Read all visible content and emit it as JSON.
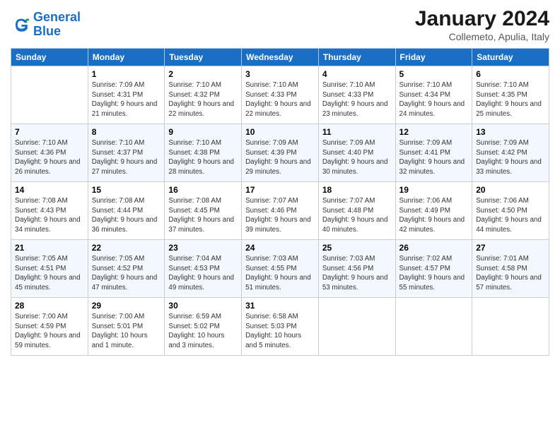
{
  "header": {
    "logo_general": "General",
    "logo_blue": "Blue",
    "month_title": "January 2024",
    "location": "Collemeto, Apulia, Italy"
  },
  "days_of_week": [
    "Sunday",
    "Monday",
    "Tuesday",
    "Wednesday",
    "Thursday",
    "Friday",
    "Saturday"
  ],
  "weeks": [
    [
      {
        "day": "",
        "sunrise": "",
        "sunset": "",
        "daylight": ""
      },
      {
        "day": "1",
        "sunrise": "Sunrise: 7:09 AM",
        "sunset": "Sunset: 4:31 PM",
        "daylight": "Daylight: 9 hours and 21 minutes."
      },
      {
        "day": "2",
        "sunrise": "Sunrise: 7:10 AM",
        "sunset": "Sunset: 4:32 PM",
        "daylight": "Daylight: 9 hours and 22 minutes."
      },
      {
        "day": "3",
        "sunrise": "Sunrise: 7:10 AM",
        "sunset": "Sunset: 4:33 PM",
        "daylight": "Daylight: 9 hours and 22 minutes."
      },
      {
        "day": "4",
        "sunrise": "Sunrise: 7:10 AM",
        "sunset": "Sunset: 4:33 PM",
        "daylight": "Daylight: 9 hours and 23 minutes."
      },
      {
        "day": "5",
        "sunrise": "Sunrise: 7:10 AM",
        "sunset": "Sunset: 4:34 PM",
        "daylight": "Daylight: 9 hours and 24 minutes."
      },
      {
        "day": "6",
        "sunrise": "Sunrise: 7:10 AM",
        "sunset": "Sunset: 4:35 PM",
        "daylight": "Daylight: 9 hours and 25 minutes."
      }
    ],
    [
      {
        "day": "7",
        "sunrise": "Sunrise: 7:10 AM",
        "sunset": "Sunset: 4:36 PM",
        "daylight": "Daylight: 9 hours and 26 minutes."
      },
      {
        "day": "8",
        "sunrise": "Sunrise: 7:10 AM",
        "sunset": "Sunset: 4:37 PM",
        "daylight": "Daylight: 9 hours and 27 minutes."
      },
      {
        "day": "9",
        "sunrise": "Sunrise: 7:10 AM",
        "sunset": "Sunset: 4:38 PM",
        "daylight": "Daylight: 9 hours and 28 minutes."
      },
      {
        "day": "10",
        "sunrise": "Sunrise: 7:09 AM",
        "sunset": "Sunset: 4:39 PM",
        "daylight": "Daylight: 9 hours and 29 minutes."
      },
      {
        "day": "11",
        "sunrise": "Sunrise: 7:09 AM",
        "sunset": "Sunset: 4:40 PM",
        "daylight": "Daylight: 9 hours and 30 minutes."
      },
      {
        "day": "12",
        "sunrise": "Sunrise: 7:09 AM",
        "sunset": "Sunset: 4:41 PM",
        "daylight": "Daylight: 9 hours and 32 minutes."
      },
      {
        "day": "13",
        "sunrise": "Sunrise: 7:09 AM",
        "sunset": "Sunset: 4:42 PM",
        "daylight": "Daylight: 9 hours and 33 minutes."
      }
    ],
    [
      {
        "day": "14",
        "sunrise": "Sunrise: 7:08 AM",
        "sunset": "Sunset: 4:43 PM",
        "daylight": "Daylight: 9 hours and 34 minutes."
      },
      {
        "day": "15",
        "sunrise": "Sunrise: 7:08 AM",
        "sunset": "Sunset: 4:44 PM",
        "daylight": "Daylight: 9 hours and 36 minutes."
      },
      {
        "day": "16",
        "sunrise": "Sunrise: 7:08 AM",
        "sunset": "Sunset: 4:45 PM",
        "daylight": "Daylight: 9 hours and 37 minutes."
      },
      {
        "day": "17",
        "sunrise": "Sunrise: 7:07 AM",
        "sunset": "Sunset: 4:46 PM",
        "daylight": "Daylight: 9 hours and 39 minutes."
      },
      {
        "day": "18",
        "sunrise": "Sunrise: 7:07 AM",
        "sunset": "Sunset: 4:48 PM",
        "daylight": "Daylight: 9 hours and 40 minutes."
      },
      {
        "day": "19",
        "sunrise": "Sunrise: 7:06 AM",
        "sunset": "Sunset: 4:49 PM",
        "daylight": "Daylight: 9 hours and 42 minutes."
      },
      {
        "day": "20",
        "sunrise": "Sunrise: 7:06 AM",
        "sunset": "Sunset: 4:50 PM",
        "daylight": "Daylight: 9 hours and 44 minutes."
      }
    ],
    [
      {
        "day": "21",
        "sunrise": "Sunrise: 7:05 AM",
        "sunset": "Sunset: 4:51 PM",
        "daylight": "Daylight: 9 hours and 45 minutes."
      },
      {
        "day": "22",
        "sunrise": "Sunrise: 7:05 AM",
        "sunset": "Sunset: 4:52 PM",
        "daylight": "Daylight: 9 hours and 47 minutes."
      },
      {
        "day": "23",
        "sunrise": "Sunrise: 7:04 AM",
        "sunset": "Sunset: 4:53 PM",
        "daylight": "Daylight: 9 hours and 49 minutes."
      },
      {
        "day": "24",
        "sunrise": "Sunrise: 7:03 AM",
        "sunset": "Sunset: 4:55 PM",
        "daylight": "Daylight: 9 hours and 51 minutes."
      },
      {
        "day": "25",
        "sunrise": "Sunrise: 7:03 AM",
        "sunset": "Sunset: 4:56 PM",
        "daylight": "Daylight: 9 hours and 53 minutes."
      },
      {
        "day": "26",
        "sunrise": "Sunrise: 7:02 AM",
        "sunset": "Sunset: 4:57 PM",
        "daylight": "Daylight: 9 hours and 55 minutes."
      },
      {
        "day": "27",
        "sunrise": "Sunrise: 7:01 AM",
        "sunset": "Sunset: 4:58 PM",
        "daylight": "Daylight: 9 hours and 57 minutes."
      }
    ],
    [
      {
        "day": "28",
        "sunrise": "Sunrise: 7:00 AM",
        "sunset": "Sunset: 4:59 PM",
        "daylight": "Daylight: 9 hours and 59 minutes."
      },
      {
        "day": "29",
        "sunrise": "Sunrise: 7:00 AM",
        "sunset": "Sunset: 5:01 PM",
        "daylight": "Daylight: 10 hours and 1 minute."
      },
      {
        "day": "30",
        "sunrise": "Sunrise: 6:59 AM",
        "sunset": "Sunset: 5:02 PM",
        "daylight": "Daylight: 10 hours and 3 minutes."
      },
      {
        "day": "31",
        "sunrise": "Sunrise: 6:58 AM",
        "sunset": "Sunset: 5:03 PM",
        "daylight": "Daylight: 10 hours and 5 minutes."
      },
      {
        "day": "",
        "sunrise": "",
        "sunset": "",
        "daylight": ""
      },
      {
        "day": "",
        "sunrise": "",
        "sunset": "",
        "daylight": ""
      },
      {
        "day": "",
        "sunrise": "",
        "sunset": "",
        "daylight": ""
      }
    ]
  ]
}
